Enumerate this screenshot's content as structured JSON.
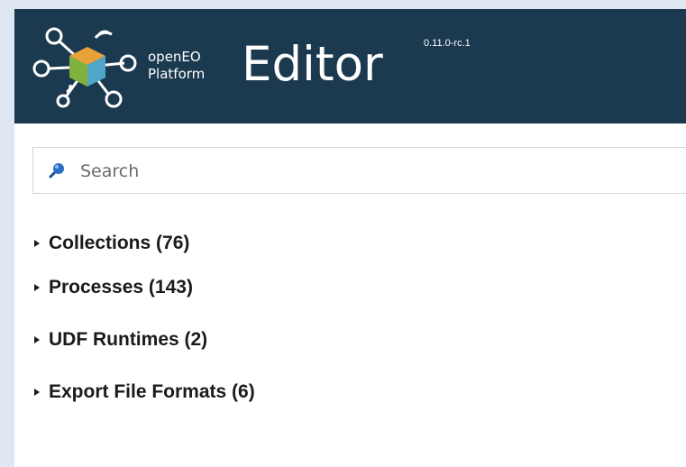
{
  "header": {
    "brand_line1": "openEO",
    "brand_line2": "Platform",
    "title": "Editor",
    "version": "0.11.0-rc.1"
  },
  "search": {
    "placeholder": "Search",
    "value": "",
    "icon": "search-icon"
  },
  "sections": [
    {
      "label": "Collections (76)"
    },
    {
      "label": "Processes (143)"
    },
    {
      "label": "UDF Runtimes (2)"
    },
    {
      "label": "Export File Formats (6)"
    }
  ],
  "colors": {
    "header_bg": "#1c3a4f",
    "logo_orange": "#e8a23a",
    "logo_green": "#7fb23c",
    "logo_blue": "#4fa6c8"
  }
}
